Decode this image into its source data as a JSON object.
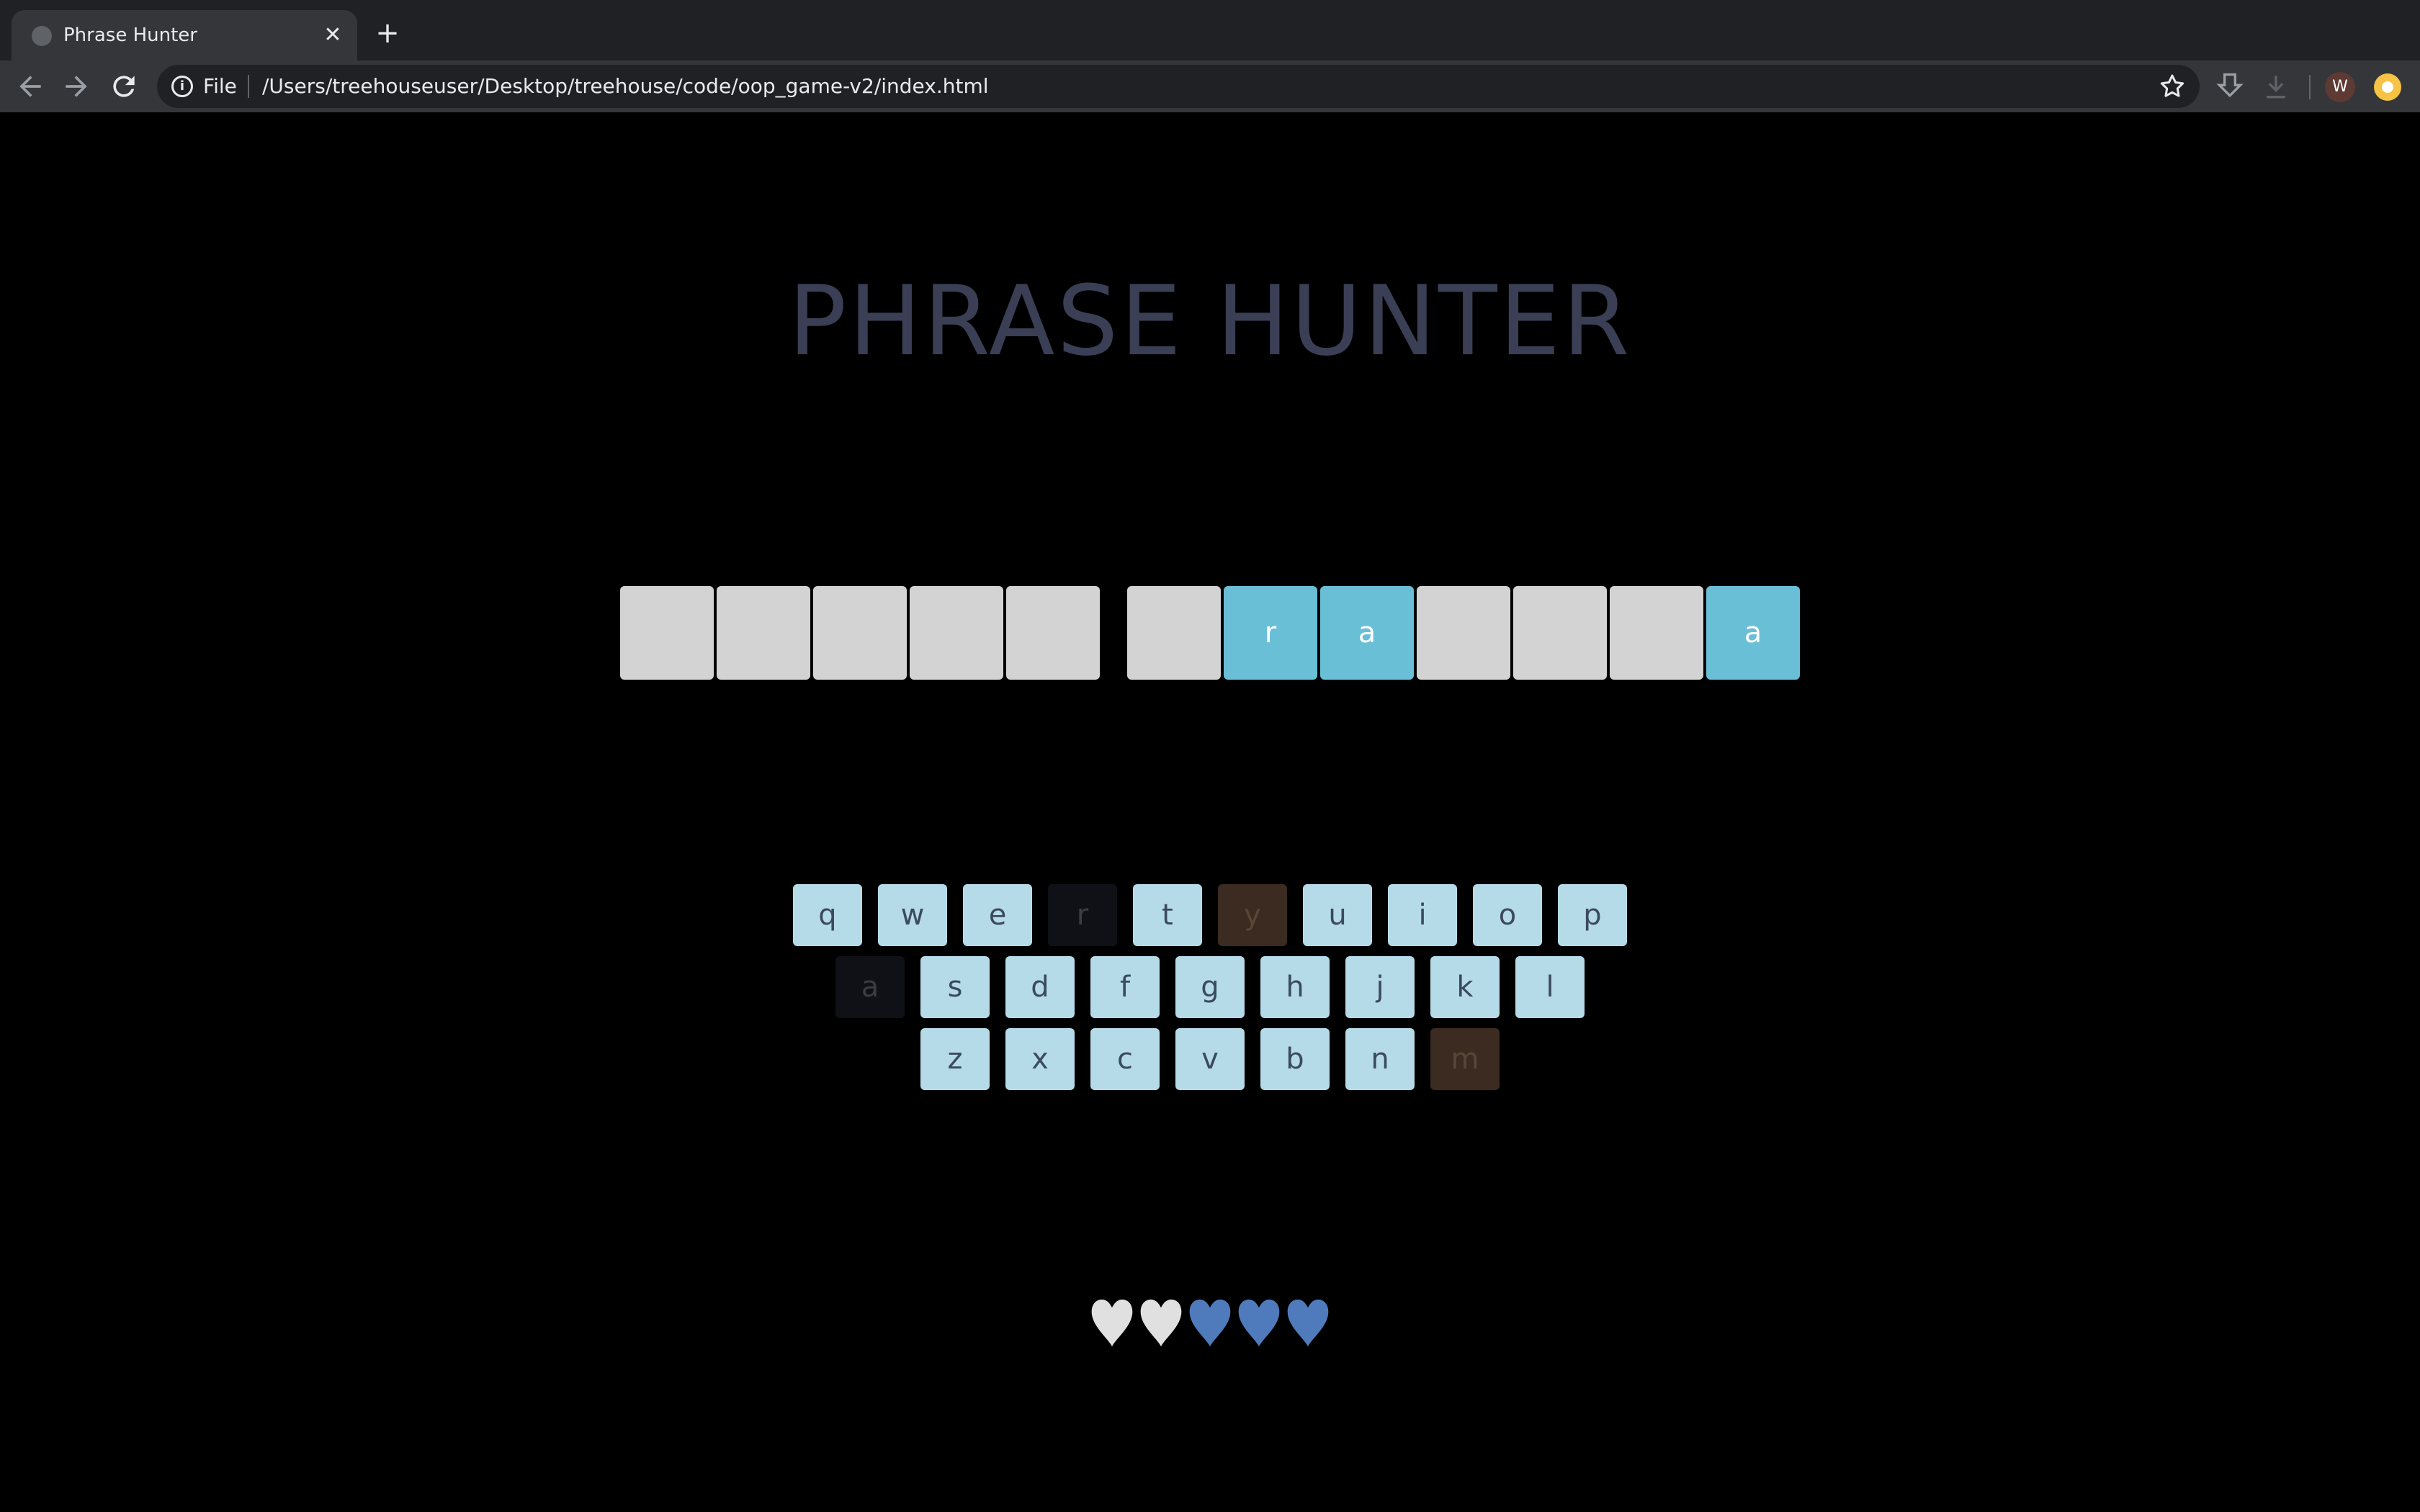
{
  "browser": {
    "tab_title": "Phrase Hunter",
    "tab_close": "✕",
    "new_tab": "+",
    "scheme_label": "File",
    "url": "/Users/treehouseuser/Desktop/treehouse/code/oop_game-v2/index.html",
    "profile_initial": "W",
    "icons": [
      "back-arrow-icon",
      "forward-arrow-icon",
      "reload-icon",
      "info-icon",
      "star-icon",
      "download-extension-icon",
      "download-icon",
      "profile-avatar",
      "extension-icon"
    ]
  },
  "game": {
    "title": "PHRASE HUNTER",
    "phrase": [
      {
        "char": "",
        "shown": false
      },
      {
        "char": "",
        "shown": false
      },
      {
        "char": "",
        "shown": false
      },
      {
        "char": "",
        "shown": false
      },
      {
        "char": "",
        "shown": false
      },
      {
        "space": true
      },
      {
        "char": "",
        "shown": false
      },
      {
        "char": "r",
        "shown": true
      },
      {
        "char": "a",
        "shown": true
      },
      {
        "char": "",
        "shown": false
      },
      {
        "char": "",
        "shown": false
      },
      {
        "char": "",
        "shown": false
      },
      {
        "char": "a",
        "shown": true
      }
    ],
    "keyboard_rows": [
      [
        {
          "key": "q",
          "state": "available"
        },
        {
          "key": "w",
          "state": "available"
        },
        {
          "key": "e",
          "state": "available"
        },
        {
          "key": "r",
          "state": "chosen"
        },
        {
          "key": "t",
          "state": "available"
        },
        {
          "key": "y",
          "state": "wrong"
        },
        {
          "key": "u",
          "state": "available"
        },
        {
          "key": "i",
          "state": "available"
        },
        {
          "key": "o",
          "state": "available"
        },
        {
          "key": "p",
          "state": "available"
        }
      ],
      [
        {
          "key": "a",
          "state": "chosen"
        },
        {
          "key": "s",
          "state": "available"
        },
        {
          "key": "d",
          "state": "available"
        },
        {
          "key": "f",
          "state": "available"
        },
        {
          "key": "g",
          "state": "available"
        },
        {
          "key": "h",
          "state": "available"
        },
        {
          "key": "j",
          "state": "available"
        },
        {
          "key": "k",
          "state": "available"
        },
        {
          "key": "l",
          "state": "available"
        }
      ],
      [
        {
          "key": "z",
          "state": "available"
        },
        {
          "key": "x",
          "state": "available"
        },
        {
          "key": "c",
          "state": "available"
        },
        {
          "key": "v",
          "state": "available"
        },
        {
          "key": "b",
          "state": "available"
        },
        {
          "key": "n",
          "state": "available"
        },
        {
          "key": "m",
          "state": "wrong"
        }
      ]
    ],
    "lives": [
      {
        "state": "lost"
      },
      {
        "state": "lost"
      },
      {
        "state": "live"
      },
      {
        "state": "live"
      },
      {
        "state": "live"
      }
    ],
    "colors": {
      "background": "#000000",
      "title": "#3a3f55",
      "hidden_letter": "#d3d3d3",
      "shown_letter": "#69bfd6",
      "key": "#b5dbe8",
      "key_chosen": "#0f1117",
      "key_wrong": "#3b2b20",
      "heart_live": "#4f7bbd",
      "heart_lost": "#e0e0e0"
    }
  }
}
